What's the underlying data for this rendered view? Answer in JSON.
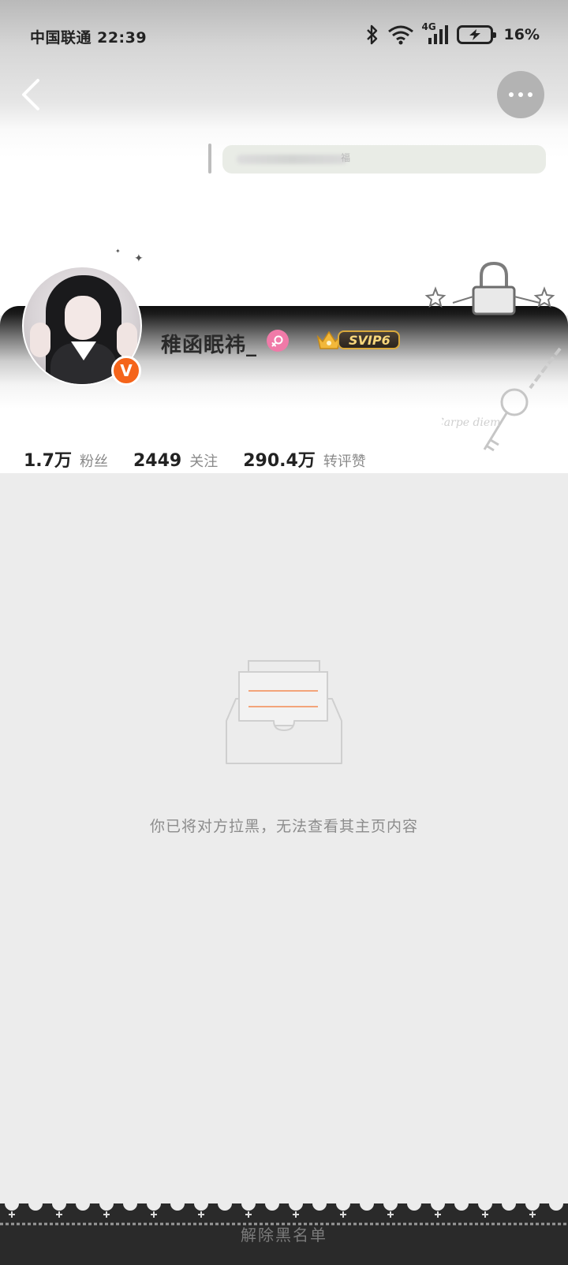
{
  "status_bar": {
    "carrier_time": "中国联通 22:39",
    "network": "4G",
    "battery": "16%"
  },
  "nav": {
    "back_icon": "chevron-left-icon",
    "more_icon": "more-dots-icon"
  },
  "profile": {
    "username": "稚函眠祎_",
    "verified_badge": "V",
    "gender_icon": "female-icon",
    "vip_label": "SVIP6",
    "stats": [
      {
        "value": "1.7万",
        "label": "粉丝"
      },
      {
        "value": "2449",
        "label": "关注"
      },
      {
        "value": "290.4万",
        "label": "转评赞"
      }
    ],
    "signature_text": "福"
  },
  "empty_state": {
    "icon": "inbox-empty-icon",
    "message": "你已将对方拉黑，无法查看其主页内容"
  },
  "bottom": {
    "unblock_label": "解除黑名单"
  },
  "colors": {
    "accent_orange": "#f5641a",
    "gender_pink": "#f07aa8",
    "vip_gold": "#f8d77c"
  }
}
